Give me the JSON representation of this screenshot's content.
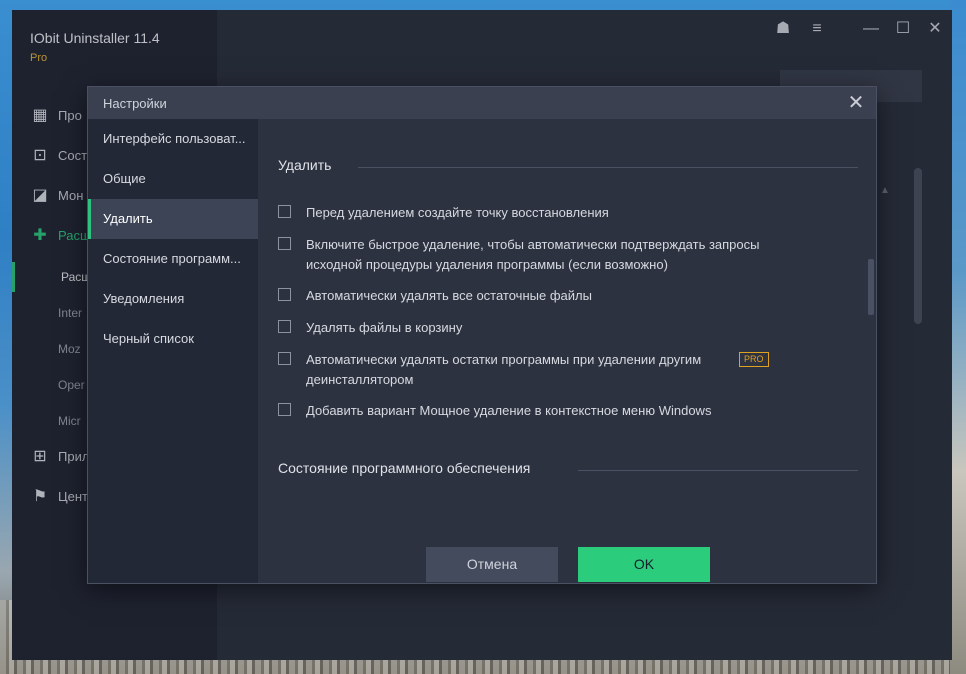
{
  "app": {
    "title": "IObit Uninstaller 11.4",
    "edition": "Pro",
    "nav": [
      {
        "label": "Про",
        "icon": "grid-icon"
      },
      {
        "label": "Сост",
        "icon": "install-icon"
      },
      {
        "label": "Мон",
        "icon": "monitor-chart-icon"
      },
      {
        "label": "Расш",
        "icon": "puzzle-icon"
      }
    ],
    "nav_sub": [
      "Расш",
      "Inter",
      "Moz",
      "Oper",
      "Micr"
    ],
    "nav_bottom": [
      {
        "label": "Прил",
        "icon": "windows-icon"
      },
      {
        "label": "Цент",
        "icon": "flag-icon"
      }
    ]
  },
  "dialog": {
    "title": "Настройки",
    "sidebar": [
      {
        "label": "Интерфейс пользоват..."
      },
      {
        "label": "Общие"
      },
      {
        "label": "Удалить"
      },
      {
        "label": "Состояние программ..."
      },
      {
        "label": "Уведомления"
      },
      {
        "label": "Черный список"
      }
    ],
    "active_index": 2,
    "section_title": "Удалить",
    "options": [
      {
        "label": "Перед удалением создайте точку восстановления",
        "checked": false
      },
      {
        "label": "Включите быстрое удаление, чтобы автоматически подтверждать запросы исходной процедуры удаления программы (если возможно)",
        "checked": false
      },
      {
        "label": "Автоматически удалять все остаточные файлы",
        "checked": false
      },
      {
        "label": "Удалять файлы в корзину",
        "checked": false
      },
      {
        "label": "Автоматически удалять остатки программы при удалении другим деинсталлятором",
        "checked": false,
        "badge": "PRO"
      },
      {
        "label": "Добавить вариант Мощное удаление в контекстное меню Windows",
        "checked": false
      }
    ],
    "next_section_title": "Состояние программного обеспечения",
    "buttons": {
      "cancel": "Отмена",
      "ok": "OK"
    }
  },
  "colors": {
    "accent": "#2ec27e",
    "pro_badge": "#e0a020",
    "dialog_bg": "#2d3240"
  }
}
